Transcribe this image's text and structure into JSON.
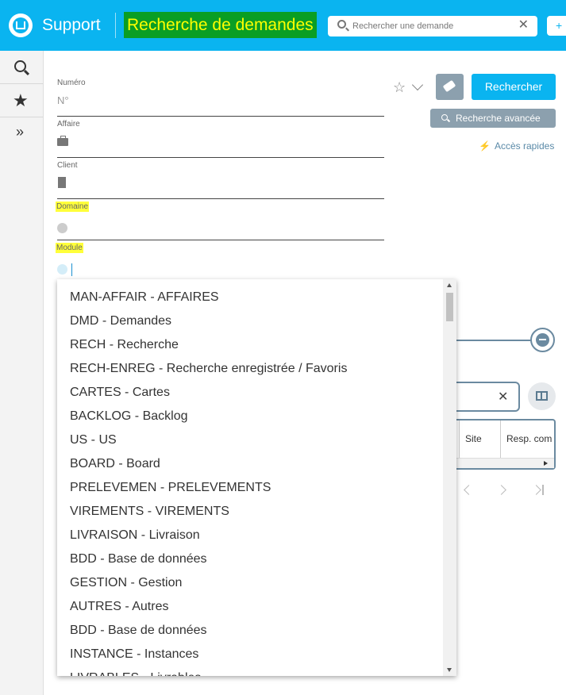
{
  "header": {
    "app_title": "Support",
    "page_title": "Recherche de demandes",
    "search_placeholder": "Rechercher une demande",
    "clear_glyph": "✕",
    "add_glyph": "+"
  },
  "sidebar": {
    "items": [
      {
        "name": "search",
        "icon": "search-icon"
      },
      {
        "name": "favorites",
        "icon": "star-icon"
      },
      {
        "name": "expand",
        "icon": "double-chevron-right-icon",
        "glyph": "»"
      }
    ]
  },
  "form": {
    "numero": {
      "label": "Numéro",
      "placeholder": "N°"
    },
    "affaire": {
      "label": "Affaire",
      "icon": "briefcase-icon"
    },
    "client": {
      "label": "Client",
      "icon": "building-icon"
    },
    "domaine": {
      "label": "Domaine",
      "icon": "circle-icon"
    },
    "module": {
      "label": "Module",
      "icon": "circle-icon",
      "value": ""
    }
  },
  "actions": {
    "favorite_glyph": "☆",
    "search_label": "Rechercher",
    "advanced_label": "Recherche avancée",
    "quick_access_label": "Accès rapides",
    "quick_access_glyph": "⚡"
  },
  "results": {
    "columns": [
      "Site",
      "Resp. com"
    ],
    "filter_clear_glyph": "✕"
  },
  "module_dropdown": {
    "options": [
      "MAN-AFFAIR - AFFAIRES",
      "DMD - Demandes",
      "RECH - Recherche",
      "RECH-ENREG - Recherche enregistrée / Favoris",
      "CARTES - Cartes",
      "BACKLOG - Backlog",
      "US - US",
      "BOARD - Board",
      "PRELEVEMEN - PRELEVEMENTS",
      "VIREMENTS - VIREMENTS",
      "LIVRAISON - Livraison",
      "BDD - Base de données",
      "GESTION - Gestion",
      "AUTRES - Autres",
      "BDD - Base de données",
      "INSTANCE - Instances",
      "LIVRABLES - Livrables"
    ]
  },
  "colors": {
    "header_bg": "#0ab4f0",
    "page_title_bg": "#0a9e24",
    "page_title_text": "#ffff00",
    "highlight": "#ffff3a",
    "secondary_button": "#8ca0ae"
  }
}
